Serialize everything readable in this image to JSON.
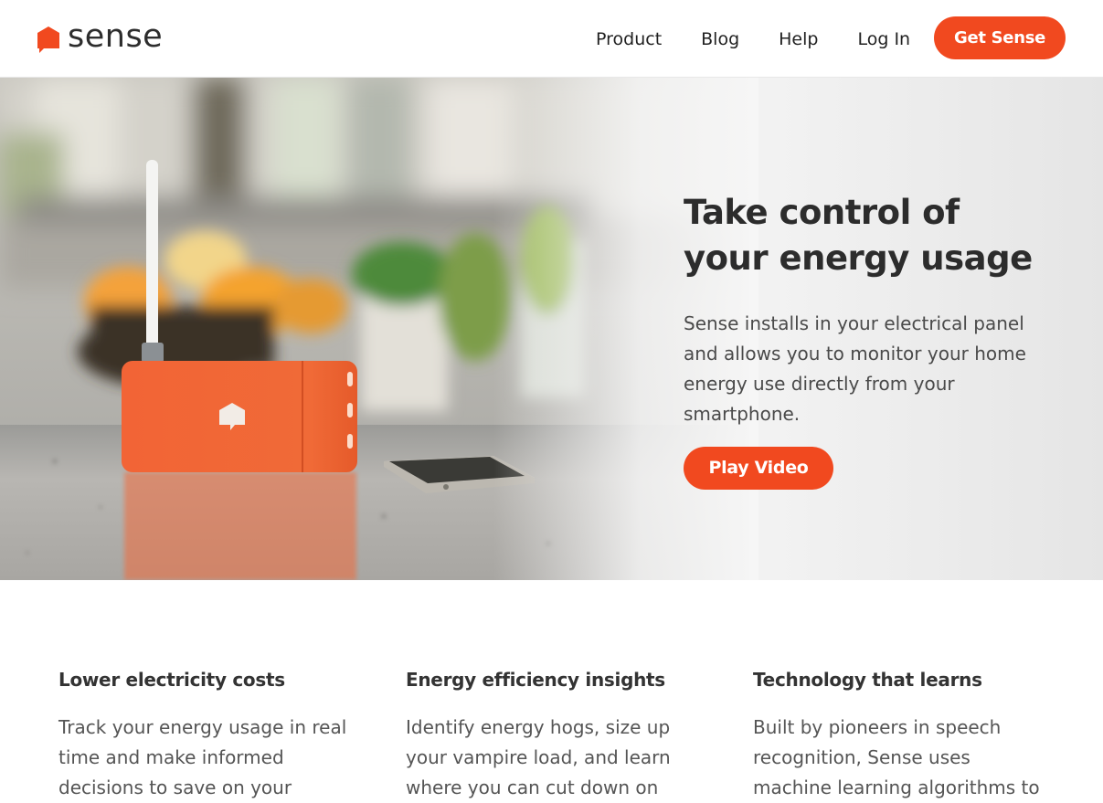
{
  "brand": {
    "name": "sense",
    "accent": "#f1491f"
  },
  "nav": {
    "items": [
      {
        "label": "Product"
      },
      {
        "label": "Blog"
      },
      {
        "label": "Help"
      },
      {
        "label": "Log In"
      }
    ],
    "cta_label": "Get Sense"
  },
  "hero": {
    "title": "Take control of your energy usage",
    "body": "Sense installs in your electrical panel and allows you to monitor your home energy use directly from your smartphone.",
    "button_label": "Play Video",
    "image_subject": "orange Sense monitor with antenna next to a smartphone on a countertop"
  },
  "features": [
    {
      "title": "Lower electricity costs",
      "body": "Track your energy usage in real time and make informed decisions to save on your"
    },
    {
      "title": "Energy efficiency insights",
      "body": "Identify energy hogs, size up your vampire load, and learn where you can cut down on"
    },
    {
      "title": "Technology that learns",
      "body": "Built by pioneers in speech recognition, Sense uses machine learning algorithms to"
    }
  ]
}
